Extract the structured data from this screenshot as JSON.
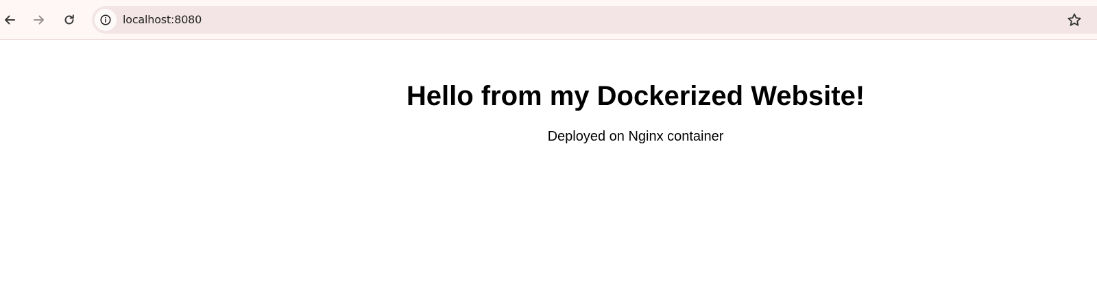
{
  "browser": {
    "url": "localhost:8080",
    "icons": {
      "back": "arrow-left-icon",
      "forward": "arrow-right-icon",
      "reload": "reload-icon",
      "site_info": "info-icon",
      "bookmark": "star-icon"
    },
    "colors": {
      "toolbar_bg": "#fff7f6",
      "omnibox_bg": "#f3e5e5"
    }
  },
  "page": {
    "heading": "Hello from my Dockerized Website!",
    "subtitle": "Deployed on Nginx container"
  }
}
